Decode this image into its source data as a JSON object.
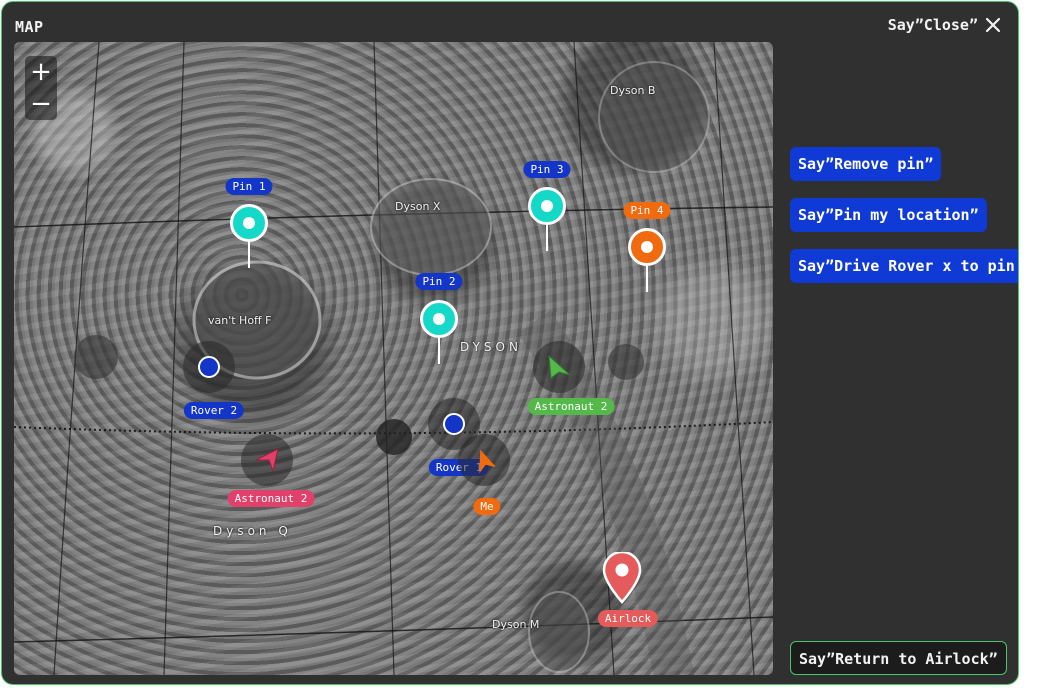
{
  "panel": {
    "title": "MAP",
    "close_label": "Say”Close”"
  },
  "map": {
    "zoom_in": "+",
    "zoom_out": "−",
    "regions": [
      "Dyson B",
      "Dyson X",
      "van't Hoff F",
      "DYSON",
      "Dyson Q",
      "Dyson M"
    ],
    "pins": [
      "Pin 1",
      "Pin 2",
      "Pin 3",
      "Pin 4"
    ],
    "entities": {
      "rover1": "Rover 1",
      "rover2": "Rover 2",
      "astronaut1": "Astronaut 2",
      "astronaut2": "Astronaut 2",
      "me": "Me",
      "airlock": "Airlock"
    }
  },
  "commands": {
    "remove_pin": "Say”Remove pin”",
    "pin_location": "Say”Pin my location”",
    "drive_rover": "Say”Drive Rover x to pin x”",
    "return_airlock": "Say”Return to Airlock”"
  },
  "colors": {
    "pin_cyan": "#14d8c8",
    "pin_orange": "#f06a10",
    "rover_blue": "#1335c8",
    "accent_green": "#4cc46a"
  }
}
